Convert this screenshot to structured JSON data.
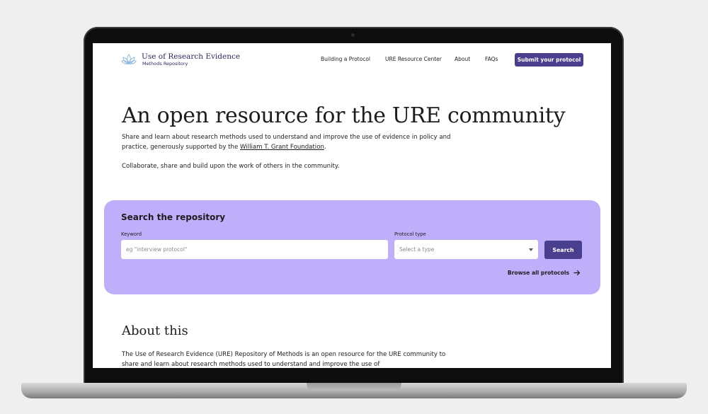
{
  "nav": {
    "brand_title": "Use of Research Evidence",
    "brand_subtitle": "Methods Repository",
    "links": [
      "Building a Protocol",
      "URE Resource Center",
      "About",
      "FAQs"
    ],
    "submit_label": "Submit your protocol"
  },
  "hero": {
    "title": "An open resource for the URE community",
    "paragraph1_before": "Share and learn about research methods used to understand and improve the use of evidence in policy and practice, generously supported by the ",
    "paragraph1_link": "William T. Grant Foundation",
    "paragraph1_after": ".",
    "paragraph2": "Collaborate, share and build upon the work of others in the community."
  },
  "search": {
    "title": "Search the repository",
    "keyword_label": "Keyword",
    "keyword_placeholder": "eg \"interview protocol\"",
    "type_label": "Protocol type",
    "type_selected": "Select a type",
    "button_label": "Search",
    "browse_label": "Browse all protocols"
  },
  "about": {
    "title": "About this",
    "paragraph": "The Use of Research Evidence (URE) Repository of Methods is an open resource for the URE community to share and learn about research methods used to understand and improve the use of"
  },
  "colors": {
    "accent": "#4a3f8f",
    "search_panel": "#bfaef9",
    "brand_text": "#2b2860"
  },
  "icons": {
    "logo": "lotus-logo-icon",
    "dropdown": "chevron-down-icon",
    "browse": "arrow-right-icon"
  }
}
